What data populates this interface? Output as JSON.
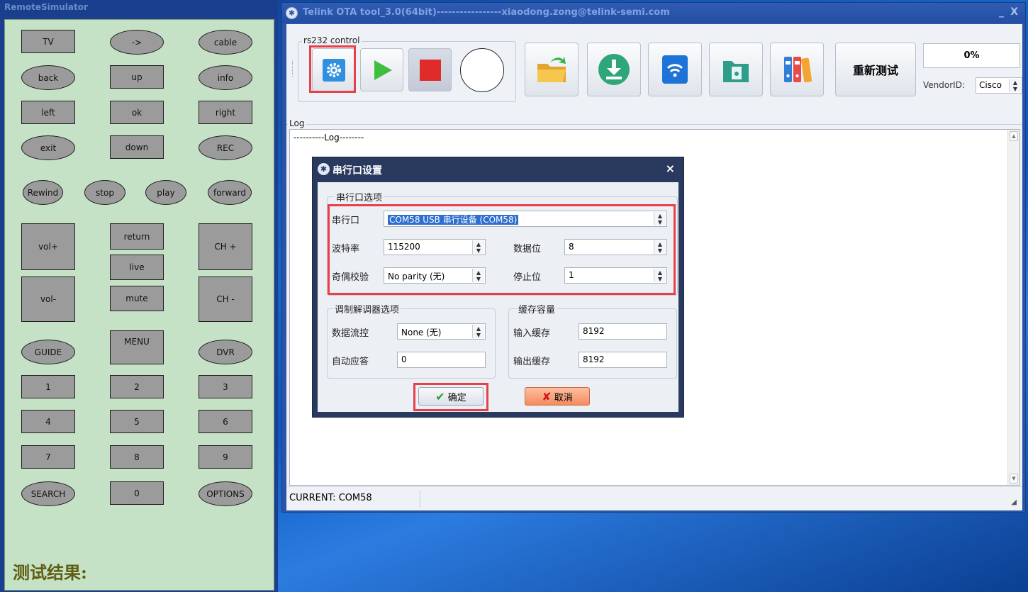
{
  "remote": {
    "title": "RemoteSimulator",
    "buttons": {
      "tv": "TV",
      "arrow": "->",
      "cable": "cable",
      "back": "back",
      "up": "up",
      "info": "info",
      "left": "left",
      "ok": "ok",
      "right": "right",
      "exit": "exit",
      "down": "down",
      "rec": "REC",
      "rewind": "Rewind",
      "stop": "stop",
      "play": "play",
      "forward": "forward",
      "vol_up": "vol+",
      "return": "return",
      "ch_up": "CH +",
      "live": "live",
      "vol_down": "vol-",
      "mute": "mute",
      "ch_down": "CH -",
      "guide": "GUIDE",
      "menu": "MENU",
      "dvr": "DVR",
      "n1": "1",
      "n2": "2",
      "n3": "3",
      "n4": "4",
      "n5": "5",
      "n6": "6",
      "n7": "7",
      "n8": "8",
      "n9": "9",
      "search": "SEARCH",
      "n0": "0",
      "options": "OPTIONS"
    },
    "result_label": "测试结果:"
  },
  "ota": {
    "title": "Telink OTA tool_3.0(64bit)-----------------xiaodong.zong@telink-semi.com",
    "minimize": "_",
    "close": "X",
    "rs232_group": "rs232 control",
    "retest_label": "重新测试",
    "progress": "0%",
    "vendor_label": "VendorID:",
    "vendor_value": "Cisco",
    "log_group": "Log",
    "log_text": "----------Log--------",
    "status": "CURRENT: COM58",
    "colors": {
      "accent_red": "#e8404a",
      "play_green": "#3fbf3f",
      "stop_red": "#e02b2b"
    }
  },
  "dialog": {
    "title": "串行口设置",
    "close": "×",
    "serial_group": "串行口选项",
    "port_label": "串行口",
    "port_value": "COM58      USB 串行设备 (COM58)",
    "baud_label": "波特率",
    "baud_value": "115200",
    "databits_label": "数据位",
    "databits_value": "8",
    "parity_label": "奇偶校验",
    "parity_value": "No parity (无)",
    "stopbits_label": "停止位",
    "stopbits_value": "1",
    "modem_group": "调制解调器选项",
    "flow_label": "数据流控",
    "flow_value": "None (无)",
    "auto_label": "自动应答",
    "auto_value": "0",
    "buffer_group": "缓存容量",
    "in_label": "输入缓存",
    "in_value": "8192",
    "out_label": "输出缓存",
    "out_value": "8192",
    "ok": "确定",
    "cancel": "取消"
  }
}
